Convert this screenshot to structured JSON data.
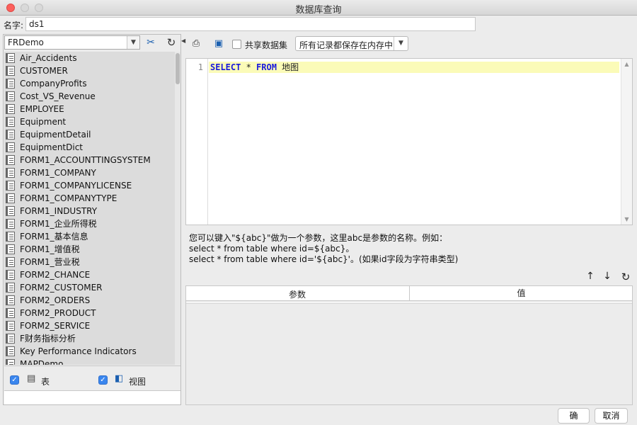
{
  "window": {
    "title": "数据库查询"
  },
  "name_field": {
    "label": "名字:",
    "value": "ds1"
  },
  "left_panel": {
    "datasource": "FRDemo",
    "tables": [
      "Air_Accidents",
      "CUSTOMER",
      "CompanyProfits",
      "Cost_VS_Revenue",
      "EMPLOYEE",
      "Equipment",
      "EquipmentDetail",
      "EquipmentDict",
      "FORM1_ACCOUNTTINGSYSTEM",
      "FORM1_COMPANY",
      "FORM1_COMPANYLICENSE",
      "FORM1_COMPANYTYPE",
      "FORM1_INDUSTRY",
      "FORM1_企业所得税",
      "FORM1_基本信息",
      "FORM1_增值税",
      "FORM1_营业税",
      "FORM2_CHANCE",
      "FORM2_CUSTOMER",
      "FORM2_ORDERS",
      "FORM2_PRODUCT",
      "FORM2_SERVICE",
      "F财务指标分析",
      "Key Performance Indicators",
      "MAPDemo"
    ],
    "filters": {
      "tables_label": "表",
      "views_label": "视图",
      "tables_checked": true,
      "views_checked": true
    }
  },
  "toolbar": {
    "share_label": "共享数据集",
    "share_checked": false,
    "memory_option": "所有记录都保存在内存中"
  },
  "editor": {
    "line_number": "1",
    "code": {
      "kw1": "SELECT",
      "star": " * ",
      "kw2": "FROM",
      "rest": " 地图"
    }
  },
  "hints": [
    "您可以键入\"${abc}\"做为一个参数，这里abc是参数的名称。例如：",
    "select * from table where id=${abc}。",
    "select * from table where id='${abc}'。(如果id字段为字符串类型)"
  ],
  "param_table": {
    "col_name": "参数",
    "col_value": "值"
  },
  "footer": {
    "ok_label": "确定",
    "cancel_label": "取消"
  },
  "colors": {
    "keyword": "#1a1adc",
    "line_highlight": "#fbfbb8",
    "checkbox": "#3a86ee"
  }
}
